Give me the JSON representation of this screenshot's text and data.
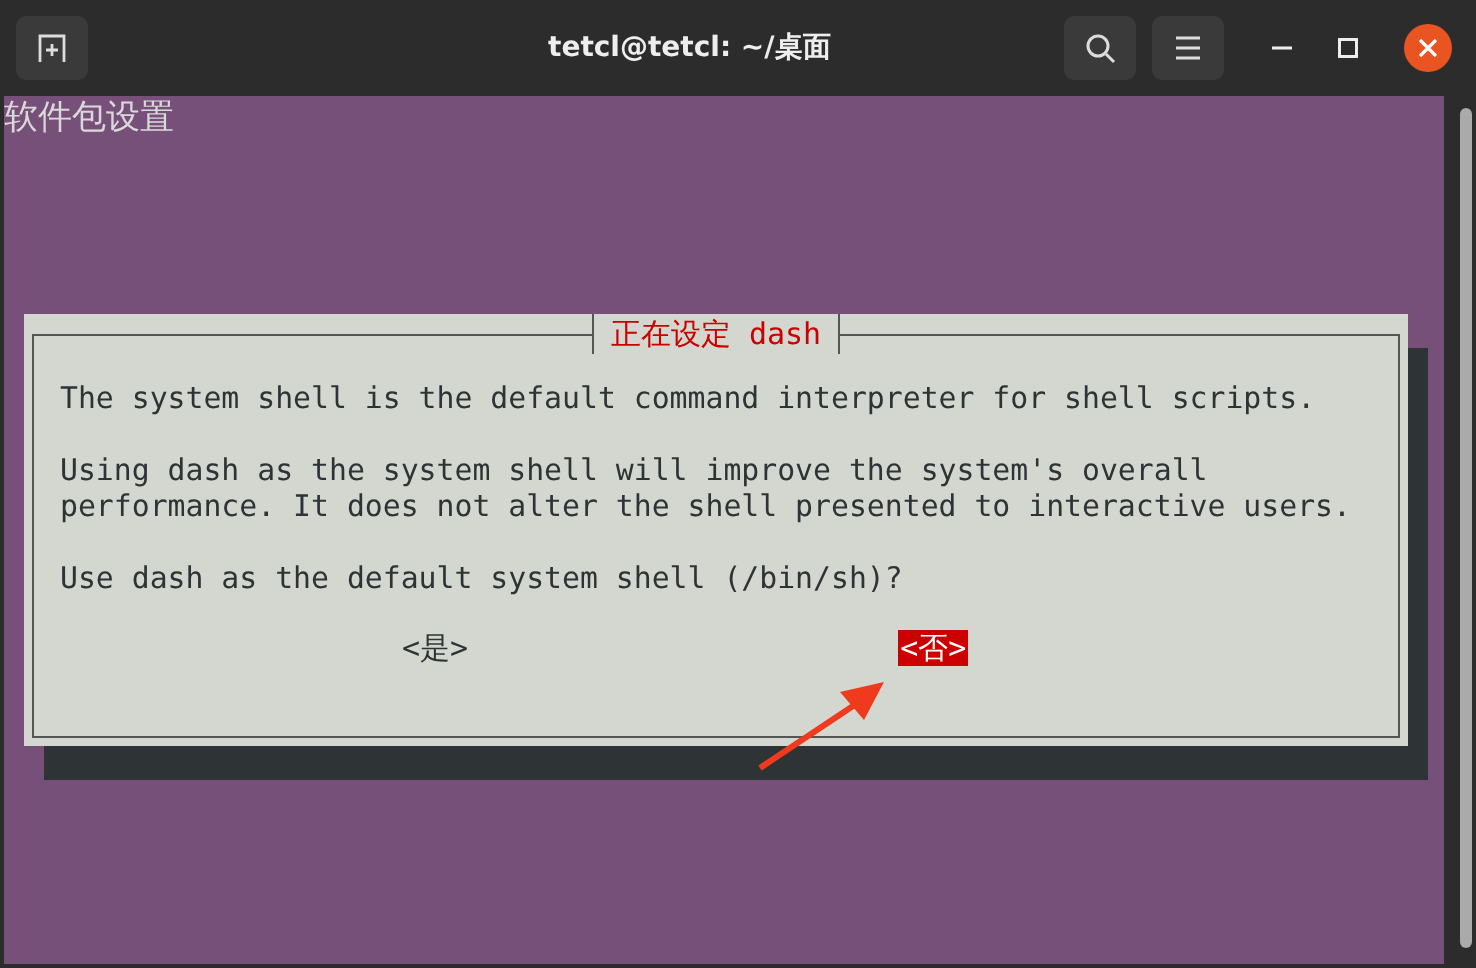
{
  "window": {
    "title": "tetcl@tetcl: ~/桌面"
  },
  "terminal": {
    "heading": "软件包设置"
  },
  "dialog": {
    "title": "正在设定 dash",
    "paragraphs": [
      "The system shell is the default command interpreter for shell scripts.",
      "Using dash as the system shell will improve the system's overall\nperformance. It does not alter the shell presented to interactive users.",
      "Use dash as the default system shell (/bin/sh)?"
    ],
    "buttons": [
      {
        "label": "<是>",
        "selected": false
      },
      {
        "label": "<否>",
        "selected": true
      }
    ]
  }
}
